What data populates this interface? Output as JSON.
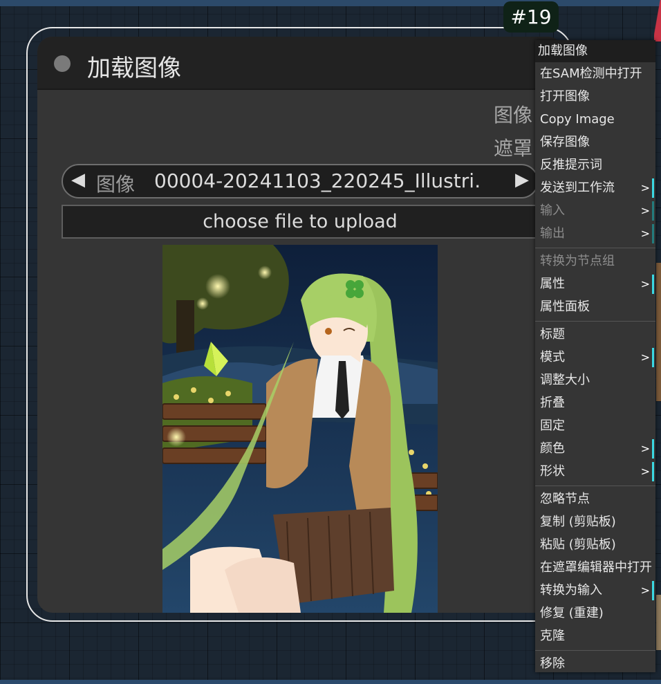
{
  "node": {
    "badge": "#19",
    "title": "加载图像",
    "outputs": [
      "图像",
      "遮罩"
    ],
    "image_combo": {
      "arrow_left": "◀",
      "label": "图像",
      "value": "00004-20241103_220245_Illustri…",
      "arrow_right": "▶"
    },
    "upload_button": "choose file to upload"
  },
  "context_menu": {
    "items": [
      {
        "label": "加载图像"
      },
      {
        "label": "在SAM检测中打开"
      },
      {
        "label": "打开图像"
      },
      {
        "label": "Copy Image"
      },
      {
        "label": "保存图像"
      },
      {
        "label": "反推提示词"
      },
      {
        "label": "发送到工作流",
        "submenu": ">"
      },
      {
        "label": "输入",
        "submenu": ">",
        "disabled": true
      },
      {
        "label": "输出",
        "submenu": ">",
        "disabled": true
      },
      {
        "separator": true
      },
      {
        "label": "转换为节点组",
        "disabled": true
      },
      {
        "label": "属性",
        "submenu": ">"
      },
      {
        "label": "属性面板"
      },
      {
        "separator": true
      },
      {
        "label": "标题"
      },
      {
        "label": "模式",
        "submenu": ">"
      },
      {
        "label": "调整大小"
      },
      {
        "label": "折叠"
      },
      {
        "label": "固定"
      },
      {
        "label": "颜色",
        "submenu": ">"
      },
      {
        "label": "形状",
        "submenu": ">"
      },
      {
        "separator": true
      },
      {
        "label": "忽略节点"
      },
      {
        "label": "复制 (剪贴板)"
      },
      {
        "label": "粘贴 (剪贴板)"
      },
      {
        "label": "在遮罩编辑器中打开"
      },
      {
        "label": "转换为输入",
        "submenu": ">"
      },
      {
        "label": "修复 (重建)"
      },
      {
        "label": "克隆"
      },
      {
        "separator": true
      },
      {
        "label": "移除"
      }
    ]
  },
  "colors": {
    "canvas_bg": "#1b2632",
    "node_body": "#353535",
    "node_header": "#222222",
    "badge_bg": "#0f2217",
    "menu_bg": "#353535",
    "submenu_accent": "#3ad9e3"
  }
}
